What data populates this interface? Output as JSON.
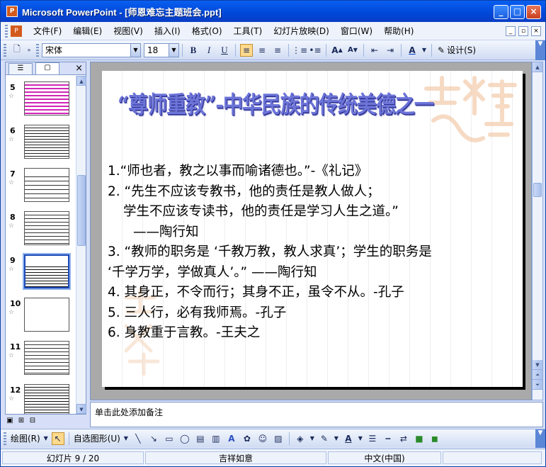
{
  "window": {
    "title": "Microsoft PowerPoint - [师恩难忘主题班会.ppt]",
    "app_icon": "P"
  },
  "menu": {
    "items": [
      "文件(F)",
      "编辑(E)",
      "视图(V)",
      "插入(I)",
      "格式(O)",
      "工具(T)",
      "幻灯片放映(D)",
      "窗口(W)",
      "帮助(H)"
    ]
  },
  "toolbar": {
    "font_name": "宋体",
    "font_size": "18",
    "bold_label": "B",
    "italic_label": "I",
    "underline_label": "U",
    "font_color_label": "A",
    "design_label": "设计(S)"
  },
  "thumbnails": {
    "items": [
      {
        "num": "5"
      },
      {
        "num": "6"
      },
      {
        "num": "7"
      },
      {
        "num": "8"
      },
      {
        "num": "9"
      },
      {
        "num": "10"
      },
      {
        "num": "11"
      },
      {
        "num": "12"
      }
    ],
    "selected": "9"
  },
  "slide": {
    "title": "“尊师重教”-中华民族的传统美德之一",
    "lines": [
      "1.“师也者，教之以事而喻诸德也。”-《礼记》",
      "2. “先生不应该专教书，他的责任是教人做人；",
      "   学生不应该专读书，他的责任是学习人生之道。”",
      "     ——陶行知",
      "3. “教师的职务是 ‘千教万教，教人求真’；学生的职务是",
      "‘千学万学，学做真人’。” ——陶行知",
      "4. 其身正，不令而行；其身不正，虽令不从。-孔子",
      "5. 三人行，必有我师焉。-孔子",
      "6. 身教重于言教。-王夫之"
    ]
  },
  "notes": {
    "placeholder": "单击此处添加备注"
  },
  "drawbar": {
    "draw_label": "绘图(R)",
    "autoshapes_label": "自选图形(U)"
  },
  "status": {
    "slide_info": "幻灯片 9 / 20",
    "design_name": "吉祥如意",
    "language": "中文(中国)"
  }
}
